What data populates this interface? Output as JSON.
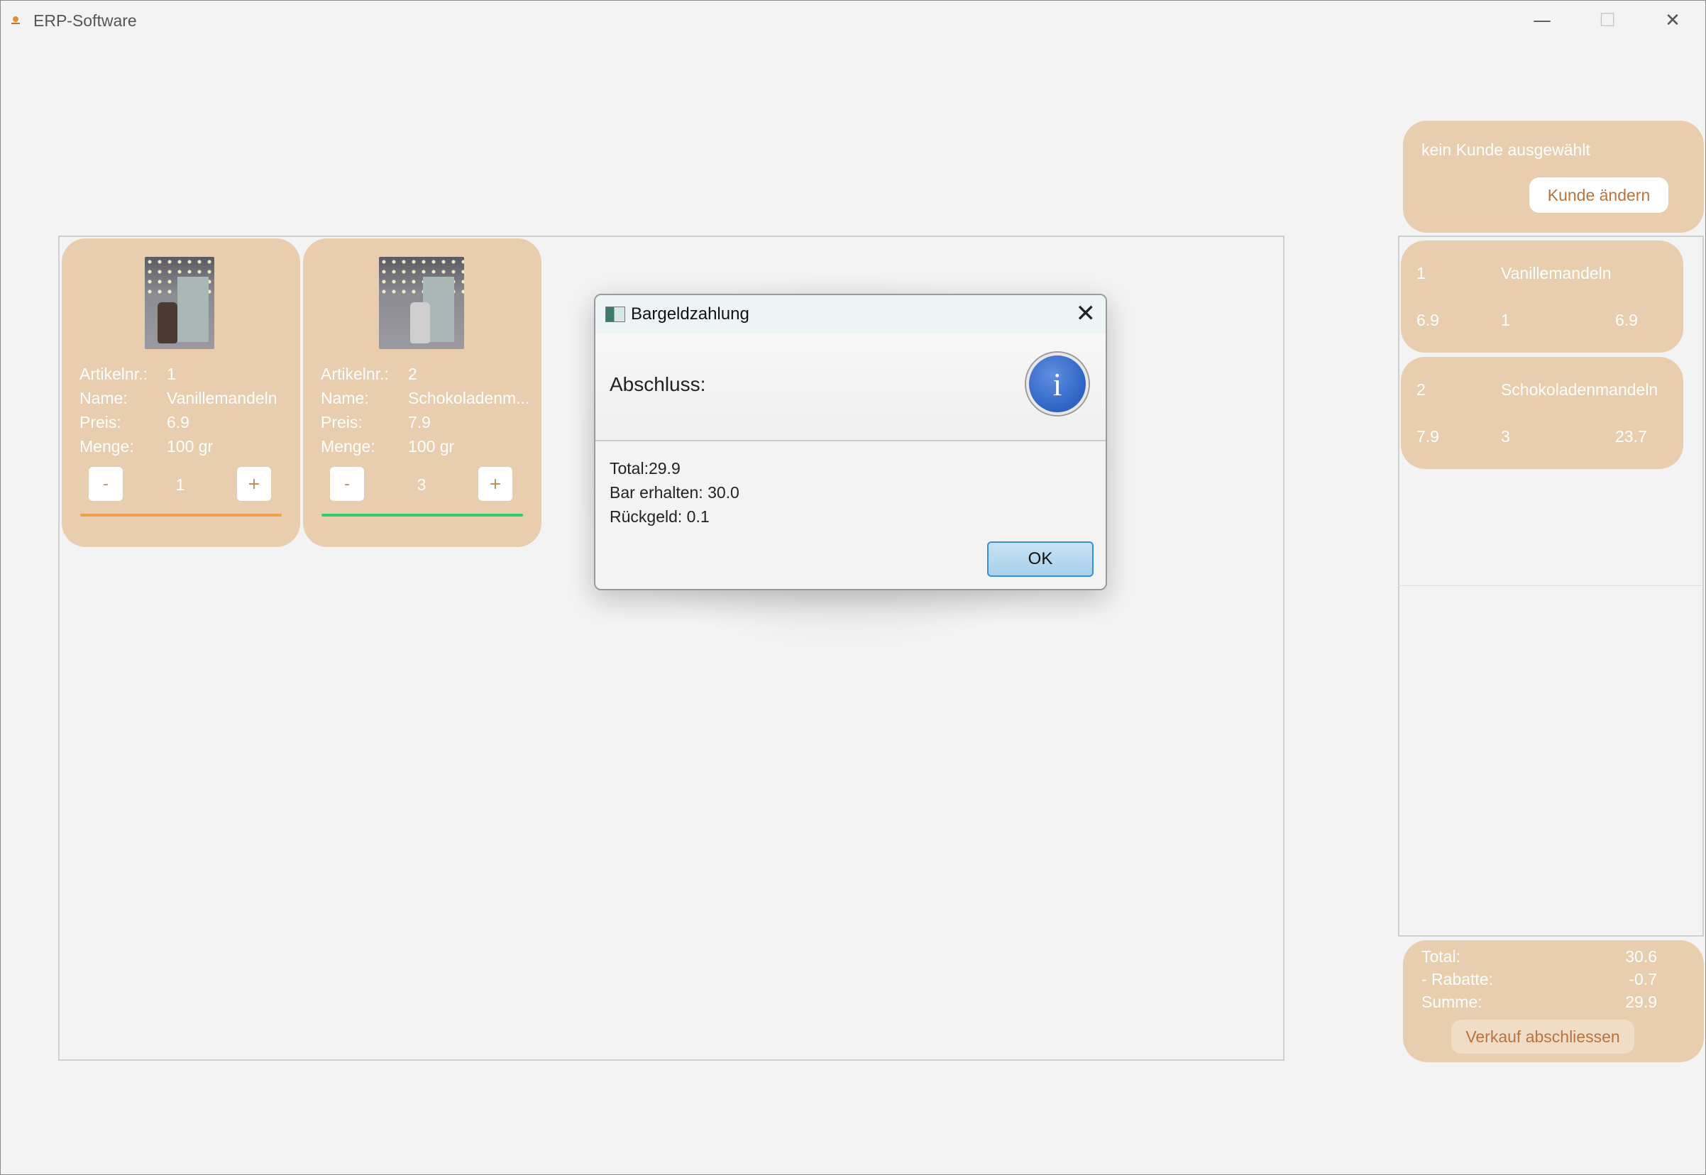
{
  "window": {
    "title": "ERP-Software",
    "controls": {
      "minimize": "—",
      "maximize": "☐",
      "close": "✕"
    }
  },
  "products": [
    {
      "labels": {
        "number": "Artikelnr.:",
        "name": "Name:",
        "price": "Preis:",
        "amount": "Menge:"
      },
      "number": "1",
      "name": "Vanillemandeln",
      "price": "6.9",
      "amount": "100 gr",
      "minus": "-",
      "plus": "+",
      "quantity": "1",
      "bar_color": "#f0a04b"
    },
    {
      "labels": {
        "number": "Artikelnr.:",
        "name": "Name:",
        "price": "Preis:",
        "amount": "Menge:"
      },
      "number": "2",
      "name": "Schokoladenm...",
      "price": "7.9",
      "amount": "100 gr",
      "minus": "-",
      "plus": "+",
      "quantity": "3",
      "bar_color": "#2ecc71"
    }
  ],
  "customer": {
    "status": "kein Kunde ausgewählt",
    "change_button": "Kunde ändern"
  },
  "cart": {
    "items": [
      {
        "number": "1",
        "name": "Vanillemandeln",
        "price": "6.9",
        "quantity": "1",
        "total": "6.9"
      },
      {
        "number": "2",
        "name": "Schokoladenmandeln",
        "price": "7.9",
        "quantity": "3",
        "total": "23.7"
      }
    ]
  },
  "summary": {
    "total_label": "Total:",
    "total_value": "30.6",
    "discount_label": "- Rabatte:",
    "discount_value": "-0.7",
    "sum_label": "Summe:",
    "sum_value": "29.9",
    "finish_button": "Verkauf abschliessen"
  },
  "dialog": {
    "title": "Bargeldzahlung",
    "close": "✕",
    "header": "Abschluss:",
    "info_icon": "i",
    "lines": [
      "Total:29.9",
      "Bar erhalten: 30.0",
      "Rückgeld: 0.1"
    ],
    "ok_button": "OK"
  },
  "colors": {
    "card": "#e8ceaf",
    "accent_text": "#b9743d",
    "info_blue": "#2e63c4"
  }
}
